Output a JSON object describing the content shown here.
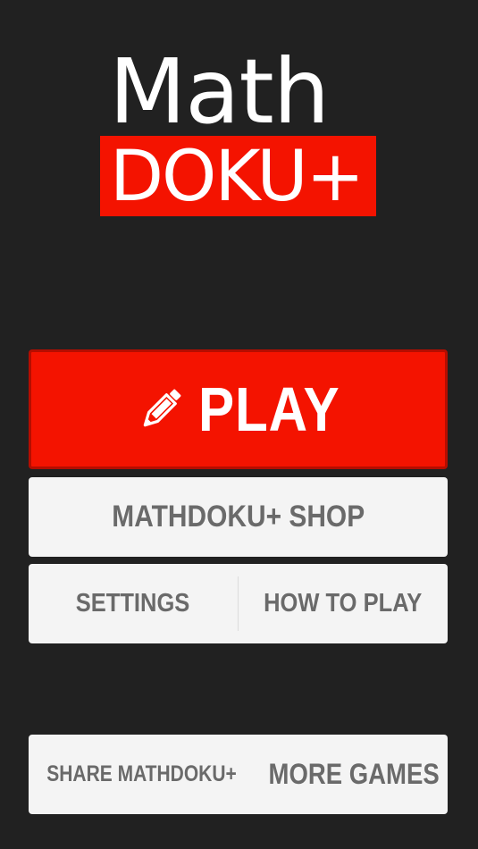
{
  "logo": {
    "line1": "Math",
    "line2": "DOKU+"
  },
  "colors": {
    "background": "#212121",
    "accent_red": "#f41300",
    "button_light": "#f4f4f4",
    "button_text_gray": "#6a6a6a"
  },
  "menu": {
    "play": {
      "label": "PLAY",
      "icon": "pencil-icon"
    },
    "shop": {
      "label": "MATHDOKU+ SHOP"
    },
    "settings": {
      "label": "SETTINGS"
    },
    "how_to_play": {
      "label": "HOW TO PLAY"
    },
    "share": {
      "label": "SHARE MATHDOKU+"
    },
    "more_games": {
      "label": "MORE GAMES"
    }
  }
}
